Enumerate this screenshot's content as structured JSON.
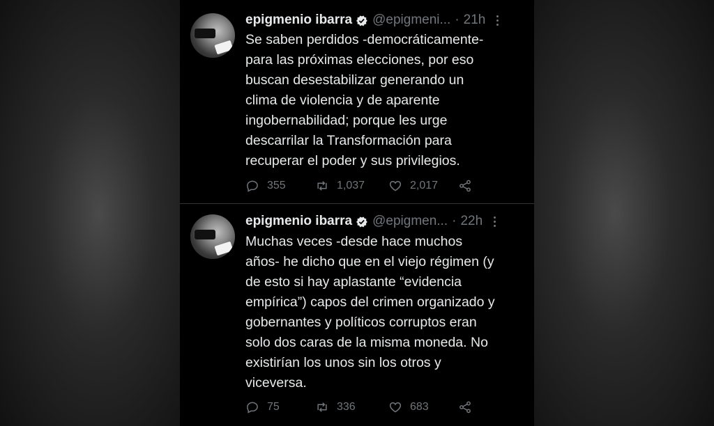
{
  "tweets": [
    {
      "name": "epigmenio ibarra",
      "handle": "@epigmeni...",
      "time": "21h",
      "text": "Se saben perdidos -democráticamente-\npara las próximas elecciones, por eso\nbuscan desestabilizar generando un\nclima de violencia y de aparente\ningobernabilidad; porque les urge\ndescarrilar la Transformación para\nrecuperar el poder y sus privilegios.",
      "replies": "355",
      "retweets": "1,037",
      "likes": "2,017",
      "avatar_stamp": "justicia"
    },
    {
      "name": "epigmenio ibarra",
      "handle": "@epigmen...",
      "time": "22h",
      "text": "Muchas veces -desde hace muchos\naños- he dicho que en el viejo régimen (y\nde esto si hay aplastante “evidencia\nempírica”) capos del crimen organizado y\ngobernantes y políticos corruptos eran\nsolo dos caras de la misma moneda. No\nexistirían los unos sin los otros y\nviceversa.",
      "replies": "75",
      "retweets": "336",
      "likes": "683",
      "avatar_stamp": "justicia"
    }
  ],
  "separator": "·",
  "icons": {
    "verified": "verified-badge-icon",
    "more": "more-options-icon",
    "reply": "reply-icon",
    "retweet": "retweet-icon",
    "like": "heart-icon",
    "share": "share-icon"
  },
  "colors": {
    "background": "#000000",
    "text": "#e7e9ea",
    "muted": "#71767b",
    "divider": "#2f3336"
  }
}
